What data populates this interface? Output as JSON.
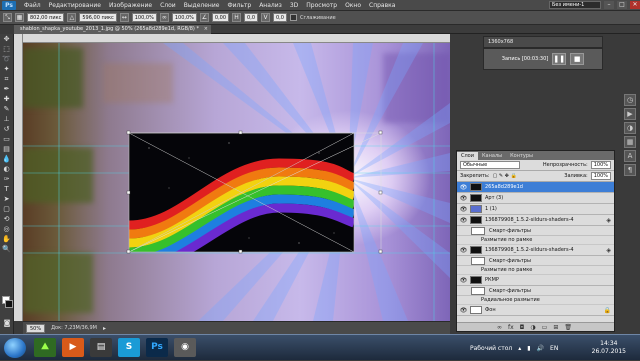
{
  "app": {
    "logo": "Ps",
    "menu": [
      "Файл",
      "Редактирование",
      "Изображение",
      "Слои",
      "Выделение",
      "Фильтр",
      "Анализ",
      "3D",
      "Просмотр",
      "Окно",
      "Справка"
    ],
    "workspace": "Без имени-1"
  },
  "options": {
    "width_value": "802,00 пикс",
    "height_value": "596,00 пикс",
    "x_percent": "100,0%",
    "y_percent": "100,0%",
    "angle": "0,00",
    "h": "0,0",
    "v": "0,0",
    "mode_label": "Сглаживание"
  },
  "document": {
    "tab_title": "shablon_shapka_youtube_2013_1.jpg @ 50% (265a8d289e1d, RGB/8) *"
  },
  "recorder": {
    "resolution": "1360x768",
    "recording": "Запись [00:03:30]"
  },
  "status": {
    "zoom": "50%",
    "doc_size": "Док: 7,23M/36,9M"
  },
  "layers_panel": {
    "tabs": [
      "Слои",
      "Каналы",
      "Контуры"
    ],
    "blend_mode": "Обычные",
    "opacity_label": "Непрозрачность:",
    "opacity_value": "100%",
    "lock_label": "Закрепить:",
    "fill_label": "Заливка:",
    "fill_value": "100%",
    "layers": [
      {
        "name": "265a8d289e1d",
        "selected": true,
        "thumb": "dark"
      },
      {
        "name": "Арт (3)",
        "selected": false,
        "thumb": "dark"
      },
      {
        "name": "1 (1)",
        "selected": false,
        "thumb": "blue"
      },
      {
        "name": "136879908_1.5.2-sildurs-shaders-4",
        "selected": false,
        "thumb": "dark",
        "mask_label": "Смарт-фильтры",
        "filter": "Размытие по рамке"
      },
      {
        "name": "136879908_1.5.2-sildurs-shaders-4",
        "selected": false,
        "thumb": "dark",
        "mask_label": "Смарт-фильтры",
        "filter": "Размытие по рамке"
      },
      {
        "name": "РКМР",
        "selected": false,
        "thumb": "dark",
        "mask_label": "Смарт-фильтры",
        "filter": "Радиальное размытие"
      },
      {
        "name": "Фон",
        "selected": false,
        "thumb": "white"
      }
    ]
  },
  "taskbar": {
    "desktop_label": "Рабочий стол",
    "lang": "EN",
    "time": "14:34",
    "date": "26.07.2015"
  },
  "colors": {
    "accent": "#3d7ed6",
    "canvas_dark": "#050509"
  }
}
